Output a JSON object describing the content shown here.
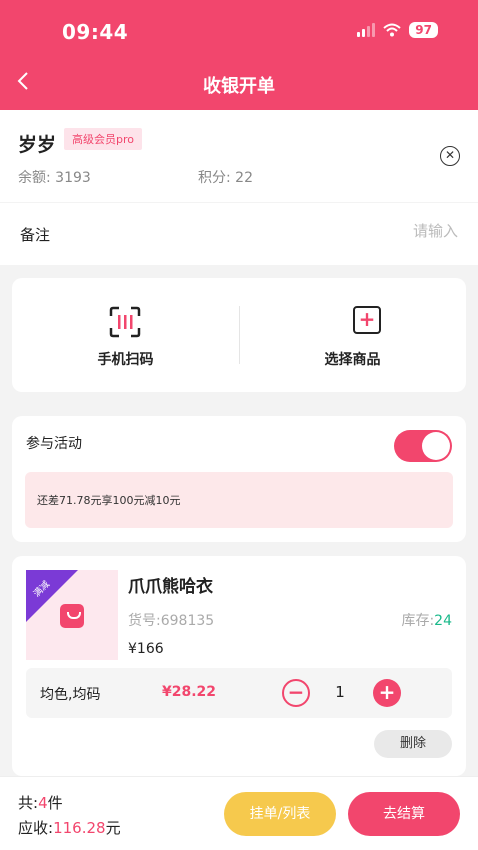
{
  "status_bar": {
    "time": "09:44",
    "battery": "97"
  },
  "nav": {
    "back_icon": "chevron-left-icon",
    "title": "收银开单"
  },
  "member": {
    "name": "岁岁",
    "level_badge": "高级会员pro",
    "balance_label": "余额:",
    "balance_value": "3193",
    "points_label": "积分:",
    "points_value": "22"
  },
  "remark": {
    "label": "备注",
    "placeholder": "请输入"
  },
  "actions": {
    "scan_label": "手机扫码",
    "select_label": "选择商品"
  },
  "activity": {
    "label": "参与活动",
    "enabled": true,
    "promo_text": "还差71.78元享100元减10元"
  },
  "product": {
    "corner_tag": "满减",
    "name": "爪爪熊哈衣",
    "sku_label": "货号:",
    "sku_value": "698135",
    "stock_label": "库存:",
    "stock_value": "24",
    "price": "¥166",
    "variant_spec": "均色,均码",
    "variant_price": "¥28.22",
    "quantity": "1",
    "delete_label": "删除"
  },
  "footer": {
    "count_prefix": "共:",
    "count_value": "4",
    "count_suffix": "件",
    "amount_prefix": "应收:",
    "amount_value": "116.28",
    "amount_suffix": "元",
    "hold_label": "挂单/列表",
    "checkout_label": "去结算"
  },
  "colors": {
    "accent": "#f2466d",
    "stock": "#19b98a",
    "hold": "#f6c94d",
    "corner": "#7b3ad6"
  }
}
